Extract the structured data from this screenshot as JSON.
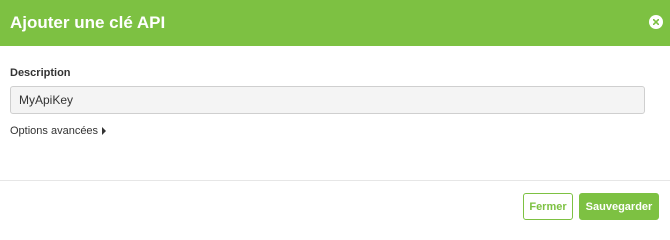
{
  "header": {
    "title": "Ajouter une clé API"
  },
  "form": {
    "description_label": "Description",
    "description_value": "MyApiKey",
    "advanced_options_label": "Options avancées"
  },
  "footer": {
    "close_label": "Fermer",
    "save_label": "Sauvegarder"
  },
  "icons": {
    "close": "close-icon",
    "advanced_toggle": "caret-right-icon"
  },
  "colors": {
    "accent": "#7dc142",
    "input_bg": "#f4f4f4"
  }
}
